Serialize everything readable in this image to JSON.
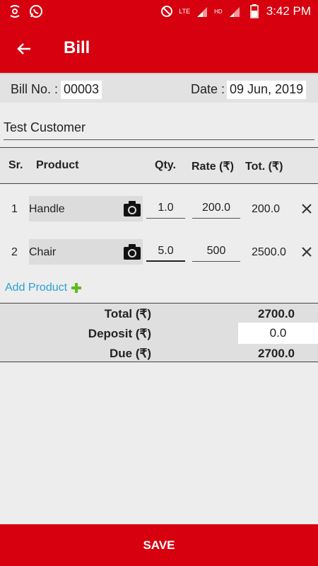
{
  "status_bar": {
    "time": "3:42 PM",
    "network": "LTE",
    "network_hd": "HD"
  },
  "app_bar": {
    "title": "Bill"
  },
  "bill": {
    "no_label": "Bill No. :",
    "no_value": "00003",
    "date_label": "Date :",
    "date_value": "09 Jun, 2019"
  },
  "customer": {
    "name": "Test Customer"
  },
  "table": {
    "headers": {
      "sr": "Sr.",
      "product": "Product",
      "qty": "Qty.",
      "rate": "Rate (₹)",
      "total": "Tot. (₹)"
    },
    "rows": [
      {
        "sr": "1",
        "product": "Handle",
        "qty": "1.0",
        "rate": "200.0",
        "total": "200.0"
      },
      {
        "sr": "2",
        "product": "Chair",
        "qty": "5.0",
        "rate": "500",
        "total": "2500.0"
      }
    ]
  },
  "add_product_label": "Add Product",
  "totals": {
    "total_label": "Total (₹)",
    "total_value": "2700.0",
    "deposit_label": "Deposit (₹)",
    "deposit_value": "0.0",
    "due_label": "Due (₹)",
    "due_value": "2700.0"
  },
  "save_label": "SAVE",
  "colors": {
    "primary": "#d7000f",
    "link": "#2a9fd6",
    "plus": "#5dbb1f"
  }
}
